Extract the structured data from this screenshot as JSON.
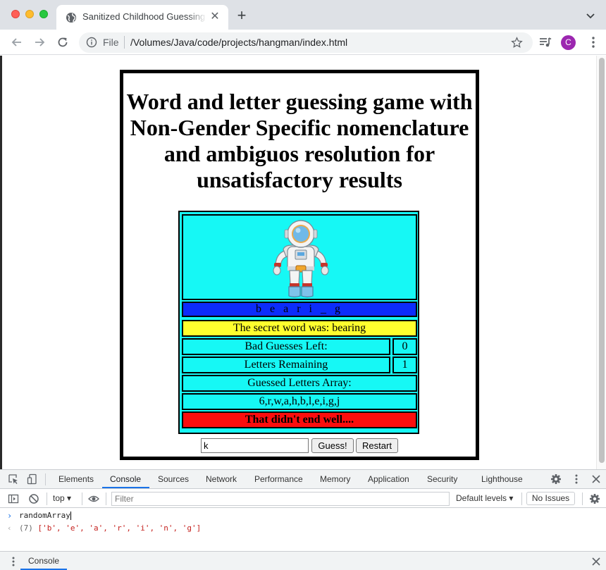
{
  "browser": {
    "tab_title": "Sanitized Childhood Guessing Game",
    "tab_close": "✕",
    "new_tab": "+",
    "file_label": "File",
    "url": "/Volumes/Java/code/projects/hangman/index.html",
    "profile_initial": "C"
  },
  "page": {
    "title": "Word and letter guessing game with Non-Gender Specific nomenclature and ambiguos resolution for unsatisfactory results",
    "image_alt": "astronaut-icon",
    "word_display": "b e a r i _ g",
    "secret_word_text": "The secret word was: bearing",
    "bad_guesses_label": "Bad Guesses Left:",
    "bad_guesses_value": "0",
    "letters_remaining_label": "Letters Remaining",
    "letters_remaining_value": "1",
    "guessed_letters_label": "Guessed Letters Array:",
    "guessed_letters_value": "6,r,w,a,h,b,l,e,i,g,j",
    "status_message": "That didn't end well....",
    "guess_input_value": "k",
    "guess_button_label": "Guess!",
    "restart_button_label": "Restart",
    "colors": {
      "table_bg": "#16f8f5",
      "word_bg": "#0c2cfb",
      "secret_bg": "#ffff2e",
      "status_bg": "#fb0e0e"
    }
  },
  "devtools": {
    "tabs": [
      "Elements",
      "Console",
      "Sources",
      "Network",
      "Performance",
      "Memory",
      "Application",
      "Security",
      "Lighthouse"
    ],
    "active_tab": "Console",
    "context": "top ▾",
    "filter_placeholder": "Filter",
    "levels": "Default levels ▾",
    "issues_label": "No Issues",
    "command": "randomArray",
    "result_count": "(7)",
    "result_values": "['b', 'e', 'a', 'r', 'i', 'n', 'g']",
    "drawer_tab": "Console"
  }
}
